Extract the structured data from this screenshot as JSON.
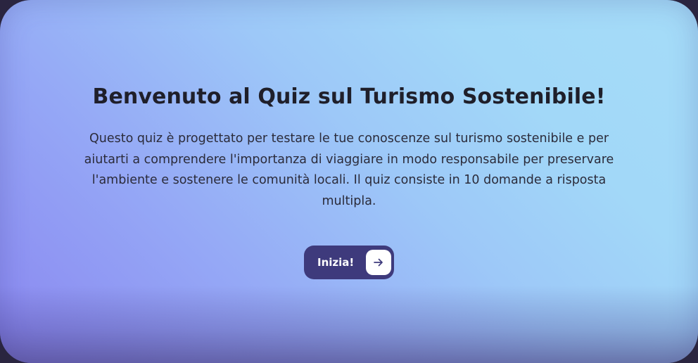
{
  "welcome": {
    "title": "Benvenuto al Quiz sul Turismo Sostenibile!",
    "description": "Questo quiz è progettato per testare le tue conoscenze sul turismo sostenibile e per aiutarti a comprendere l'importanza di viaggiare in modo responsabile per preservare l'ambiente e sostenere le comunità locali. Il quiz consiste in 10 domande a risposta multipla.",
    "start_label": "Inizia!",
    "start_icon": "arrow-right-icon"
  },
  "colors": {
    "button_bg": "#3e3a7c",
    "title_text": "#1f1f2a",
    "gradient_start": "#8a86f0",
    "gradient_end": "#a5dcf8"
  }
}
